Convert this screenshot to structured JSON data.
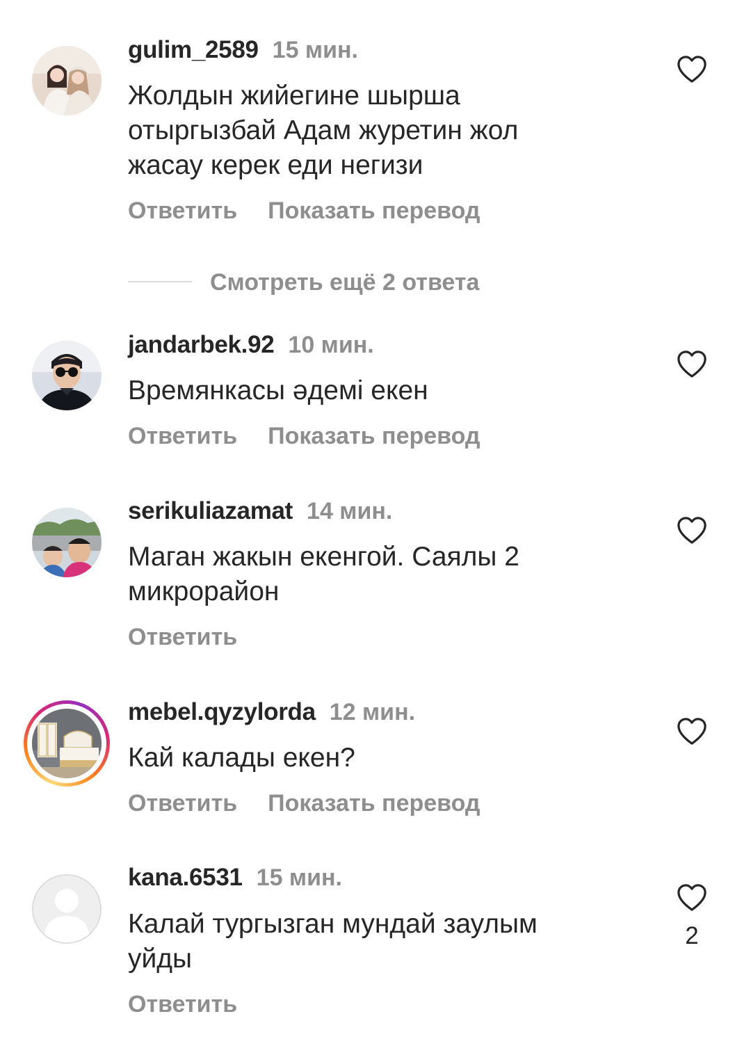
{
  "comments": [
    {
      "username": "gulim_2589",
      "time": "15 мин.",
      "text_lines": [
        "Жолдын жийегине шырша",
        "отыргызбай Адам журетин жол",
        "жасау керек еди негизи"
      ],
      "reply_label": "Ответить",
      "translate_label": "Показать перевод",
      "avatar_icon": "photo-avatar-two-women"
    },
    {
      "username": "jandarbek.92",
      "time": "10 мин.",
      "text_lines": [
        "Времянкасы әдемі екен"
      ],
      "reply_label": "Ответить",
      "translate_label": "Показать перевод",
      "avatar_icon": "photo-avatar-man-sunglasses"
    },
    {
      "username": "serikuliazamat",
      "time": "14 мин.",
      "text_lines": [
        "Маган жакын екенгой. Саялы 2",
        "микрорайон"
      ],
      "reply_label": "Ответить",
      "avatar_icon": "photo-avatar-selfie-outdoors"
    },
    {
      "username": "mebel.qyzylorda",
      "time": "12 мин.",
      "text_lines": [
        "Кай калады екен?"
      ],
      "reply_label": "Ответить",
      "translate_label": "Показать перевод",
      "avatar_icon": "photo-avatar-bedroom-furniture",
      "has_story_ring": true
    },
    {
      "username": "kana.6531",
      "time": "15 мин.",
      "text_lines": [
        "Калай тургызган мундай заулым",
        "уйды"
      ],
      "reply_label": "Ответить",
      "like_count": "2",
      "avatar_icon": "default-user-avatar"
    }
  ],
  "more_replies_label": "Смотреть ещё 2 ответа",
  "colors": {
    "text_primary": "#262626",
    "text_secondary": "#8e8e8e",
    "divider": "#dbdbdb",
    "story_ring": [
      "#feda75",
      "#fa7e1e",
      "#d62976",
      "#962fbf"
    ]
  }
}
